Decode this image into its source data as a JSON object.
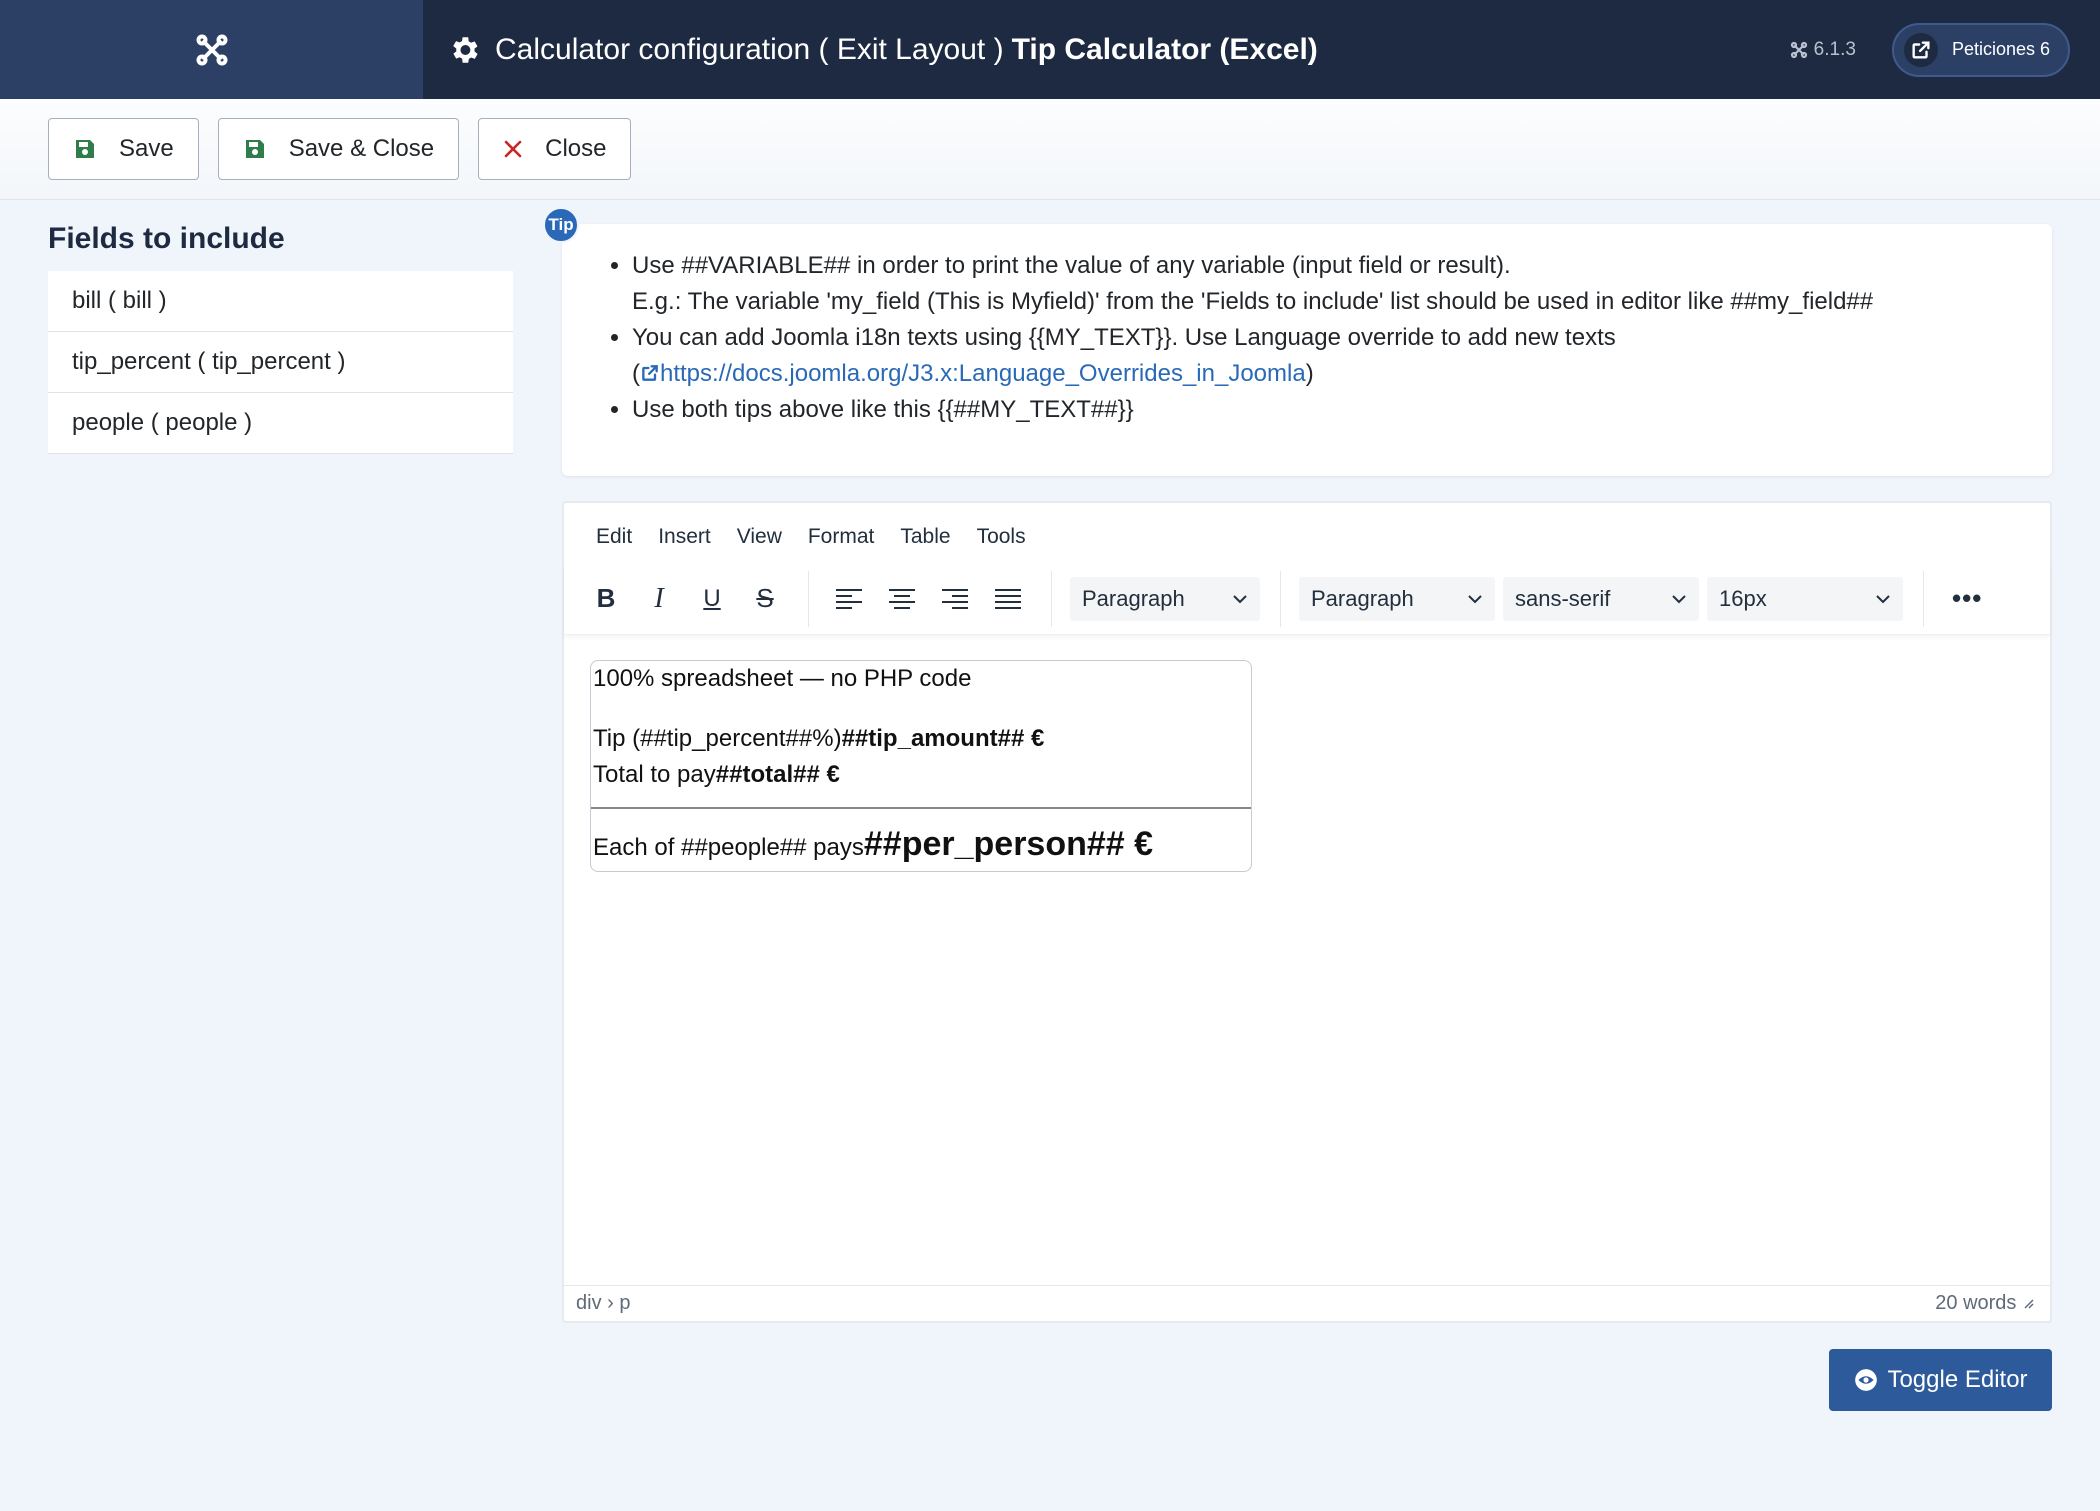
{
  "header": {
    "title_prefix": "Calculator configuration ( Exit Layout )",
    "title_strong": "Tip Calculator (Excel)",
    "version": "6.1.3",
    "peticiones_label": "Peticiones 6"
  },
  "toolbar": {
    "save_label": "Save",
    "save_close_label": "Save & Close",
    "close_label": "Close"
  },
  "sidebar": {
    "title": "Fields to include",
    "items": [
      "bill ( bill )",
      "tip_percent ( tip_percent )",
      "people ( people )"
    ]
  },
  "tip": {
    "badge": "Tip",
    "line1": "Use ##VARIABLE## in order to print the value of any variable (input field or result).",
    "line1b": "E.g.: The variable 'my_field (This is Myfield)' from the 'Fields to include' list should be used in editor like ##my_field##",
    "line2": "You can add Joomla i18n texts using {{MY_TEXT}}. Use Language override to add new texts",
    "line2_open": "(",
    "link": "https://docs.joomla.org/J3.x:Language_Overrides_in_Joomla",
    "line2_close": ")",
    "line3": "Use both tips above like this {{##MY_TEXT##}}"
  },
  "editor": {
    "menu": [
      "Edit",
      "Insert",
      "View",
      "Format",
      "Table",
      "Tools"
    ],
    "block_select": "Paragraph",
    "block_select2": "Paragraph",
    "font_family": "sans-serif",
    "font_size": "16px",
    "content": {
      "line1": "100% spreadsheet — no PHP code",
      "line2_text": "Tip (##tip_percent##%)",
      "line2_bold": "##tip_amount## €",
      "line3_text": "Total to pay",
      "line3_bold": "##total## €",
      "line4_text": "Each of ##people## pays",
      "line4_big": "##per_person## €"
    },
    "path": "div › p",
    "word_count": "20 words"
  },
  "toggle_label": "Toggle Editor",
  "colors": {
    "header_bg": "#1d2a41",
    "logo_bg": "#2c4066",
    "accent": "#2a69b8",
    "toggle_bg": "#2c5a9a",
    "save_icon": "#2f7d4a",
    "close_icon": "#c52827"
  }
}
